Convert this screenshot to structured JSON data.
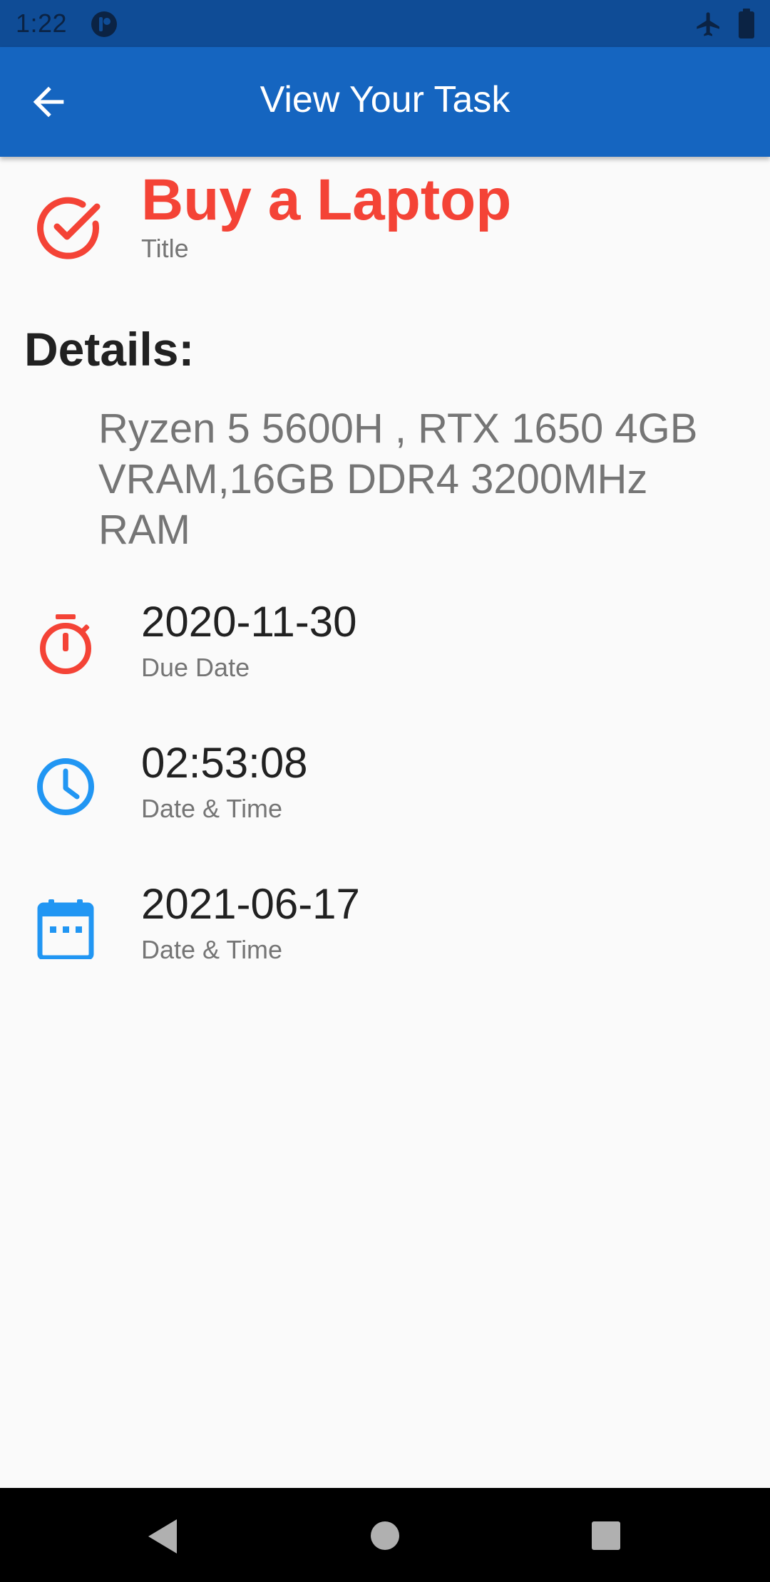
{
  "status_bar": {
    "time": "1:22",
    "notification_icon": "app-notification-icon",
    "airplane_icon": "airplane-mode-icon",
    "battery_icon": "battery-icon"
  },
  "app_bar": {
    "title": "View Your Task",
    "back_icon": "arrow-back-icon",
    "background_color": "#1565c0"
  },
  "task": {
    "title": "Buy a Laptop",
    "title_caption": "Title",
    "title_icon": "check-circle-icon",
    "title_color": "#f44336"
  },
  "details": {
    "heading": "Details:",
    "text": "Ryzen 5 5600H , RTX 1650 4GB VRAM,16GB DDR4 3200MHz RAM"
  },
  "info_rows": [
    {
      "value": "2020-11-30",
      "caption": "Due Date",
      "icon": "timer-icon",
      "icon_color": "#f44336"
    },
    {
      "value": "02:53:08",
      "caption": "Date & Time",
      "icon": "clock-icon",
      "icon_color": "#2196f3"
    },
    {
      "value": "2021-06-17",
      "caption": "Date & Time",
      "icon": "calendar-icon",
      "icon_color": "#2196f3"
    }
  ],
  "nav_bar": {
    "back_icon": "nav-back-icon",
    "home_icon": "nav-home-icon",
    "recents_icon": "nav-recents-icon"
  }
}
